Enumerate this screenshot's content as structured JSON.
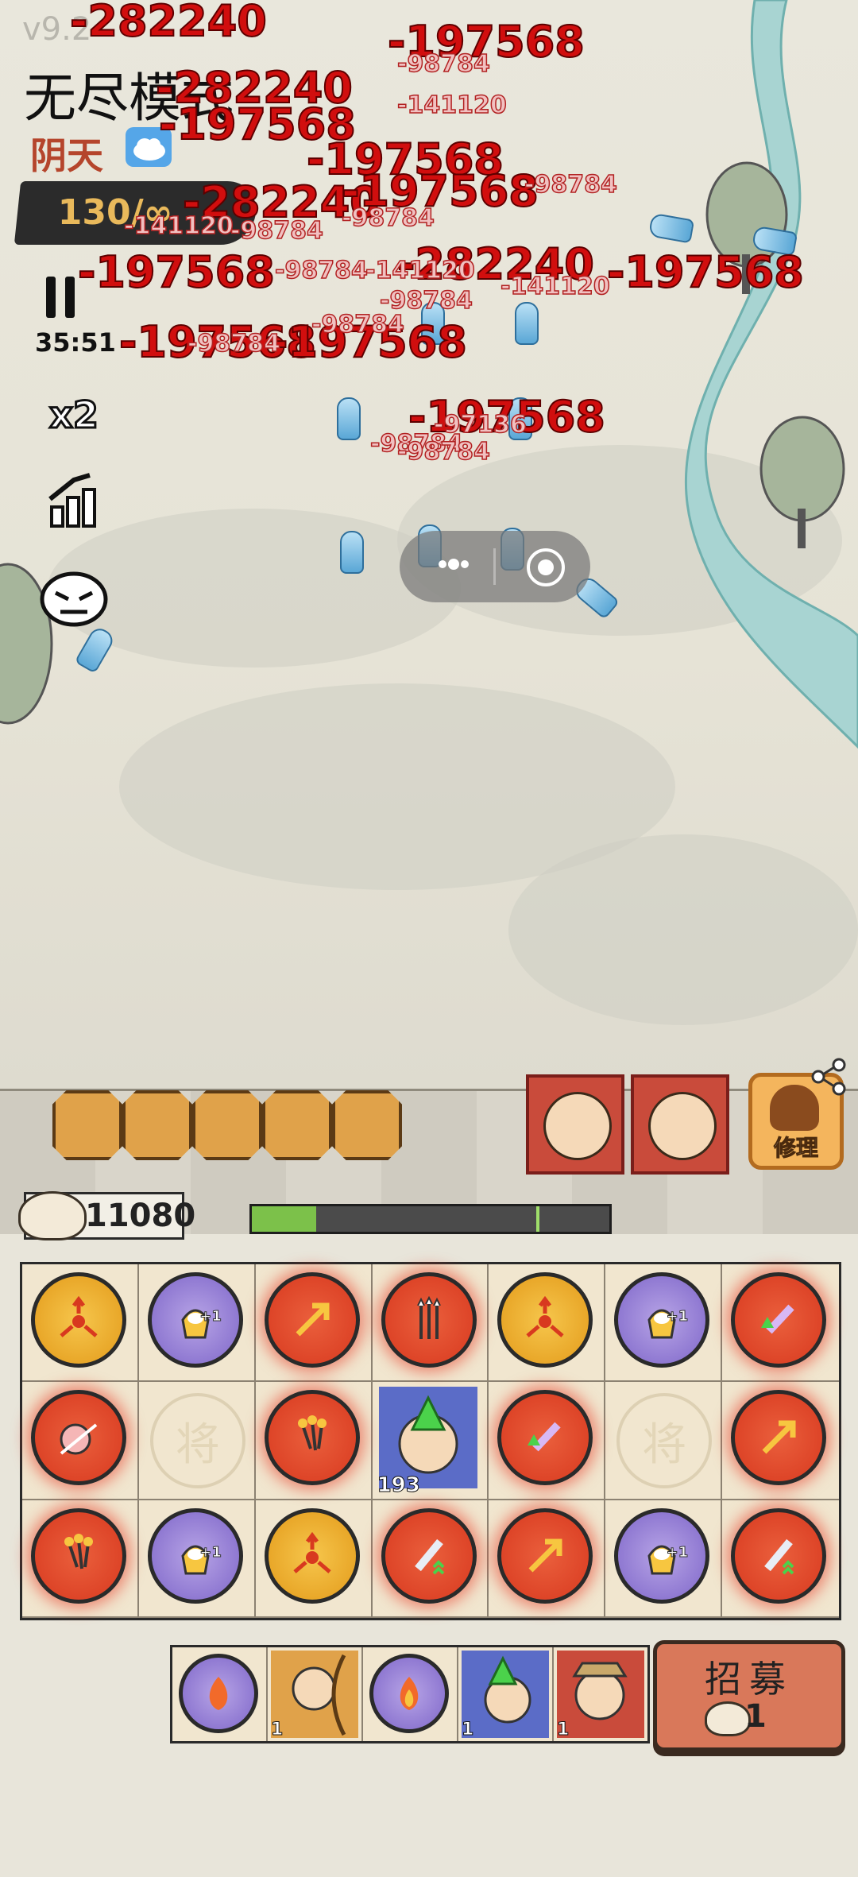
{
  "version": "v9.2",
  "mode_title": "无尽模式",
  "weather": {
    "label": "阴天",
    "icon": "cloud-icon"
  },
  "energy": {
    "text": "130/∞"
  },
  "timer": "35:51",
  "speed": {
    "label": "x2"
  },
  "side_icons": [
    "pause-icon",
    "stats-up-icon",
    "demon-face-icon"
  ],
  "damage_numbers": [
    {
      "text": "-282240",
      "size": "l"
    },
    {
      "text": "-197568",
      "size": "l"
    },
    {
      "text": "-282240",
      "size": "l"
    },
    {
      "text": "-197568",
      "size": "l"
    },
    {
      "text": "-197568",
      "size": "l"
    },
    {
      "text": "-282240",
      "size": "l"
    },
    {
      "text": "-197568",
      "size": "l"
    },
    {
      "text": "-197568",
      "size": "l"
    },
    {
      "text": "-197568",
      "size": "l"
    },
    {
      "text": "-282240",
      "size": "l"
    },
    {
      "text": "-197568",
      "size": "l"
    },
    {
      "text": "-197568",
      "size": "l"
    },
    {
      "text": "-197568",
      "size": "l"
    },
    {
      "text": "-98784",
      "size": "s"
    },
    {
      "text": "-141120",
      "size": "s"
    },
    {
      "text": "-98784",
      "size": "s"
    },
    {
      "text": "-141120",
      "size": "s"
    },
    {
      "text": "-98784",
      "size": "s"
    },
    {
      "text": "-98784",
      "size": "s"
    },
    {
      "text": "-141120",
      "size": "s"
    },
    {
      "text": "-98784",
      "size": "s"
    },
    {
      "text": "-141120",
      "size": "s"
    },
    {
      "text": "-98784",
      "size": "s"
    },
    {
      "text": "-98784",
      "size": "s"
    },
    {
      "text": "-97136",
      "size": "s"
    },
    {
      "text": "-98784",
      "size": "s"
    },
    {
      "text": "-98784",
      "size": "s"
    },
    {
      "text": "-98784",
      "size": "s"
    }
  ],
  "hero_slots": [
    "arrows-skill-icon",
    "horse-hero-icon",
    "scroll-skill-icon",
    "scholar-hero-icon",
    "warrior-hero-icon"
  ],
  "captives": [
    {
      "name": "farmer-hero-icon"
    },
    {
      "name": "long-hair-hero-icon"
    }
  ],
  "repair": {
    "label": "修理"
  },
  "share_icon": "share-icon",
  "buns": {
    "count": "11080"
  },
  "wall_hp": {
    "fraction": 0.18
  },
  "grid": [
    [
      {
        "t": "gold",
        "i": "split-arrows-icon"
      },
      {
        "t": "purple",
        "i": "bun-bag-icon",
        "plus": "+1"
      },
      {
        "t": "red",
        "i": "arrow-icon"
      },
      {
        "t": "red",
        "i": "arrow-volley-icon"
      },
      {
        "t": "gold",
        "i": "split-arrows-icon"
      },
      {
        "t": "purple",
        "i": "bun-bag-icon",
        "plus": "+1"
      },
      {
        "t": "red",
        "i": "sword-up-icon"
      }
    ],
    [
      {
        "t": "red",
        "i": "peach-slash-icon"
      },
      {
        "t": "empty",
        "i": "将"
      },
      {
        "t": "red",
        "i": "triple-arrows-icon"
      },
      {
        "t": "hero",
        "i": "hero-upgrade-icon",
        "count": "193"
      },
      {
        "t": "red",
        "i": "sword-up-icon"
      },
      {
        "t": "empty",
        "i": "将"
      },
      {
        "t": "red",
        "i": "arrow-icon"
      }
    ],
    [
      {
        "t": "red",
        "i": "triple-arrows-icon"
      },
      {
        "t": "purple",
        "i": "bun-bag-icon",
        "plus": "+1"
      },
      {
        "t": "gold",
        "i": "split-arrows-icon"
      },
      {
        "t": "red",
        "i": "sword-icon"
      },
      {
        "t": "red",
        "i": "arrow-icon"
      },
      {
        "t": "purple",
        "i": "bun-bag-icon",
        "plus": "+1"
      },
      {
        "t": "red",
        "i": "sword-icon"
      }
    ]
  ],
  "bench": [
    {
      "icon": "fire-up-icon",
      "num": ""
    },
    {
      "icon": "archer-hero-icon",
      "num": "1"
    },
    {
      "icon": "fire-icon",
      "num": ""
    },
    {
      "icon": "upgrade-hero-icon",
      "num": "1"
    },
    {
      "icon": "farmer-hero-icon",
      "num": "1"
    }
  ],
  "recruit": {
    "label": "招募",
    "cost": "1"
  },
  "colors": {
    "damage": "#d10e0e",
    "orb_red": "#d8391f",
    "orb_gold": "#e39a1a",
    "orb_purple": "#7e66c9",
    "hp_fill": "#7cc14a"
  }
}
